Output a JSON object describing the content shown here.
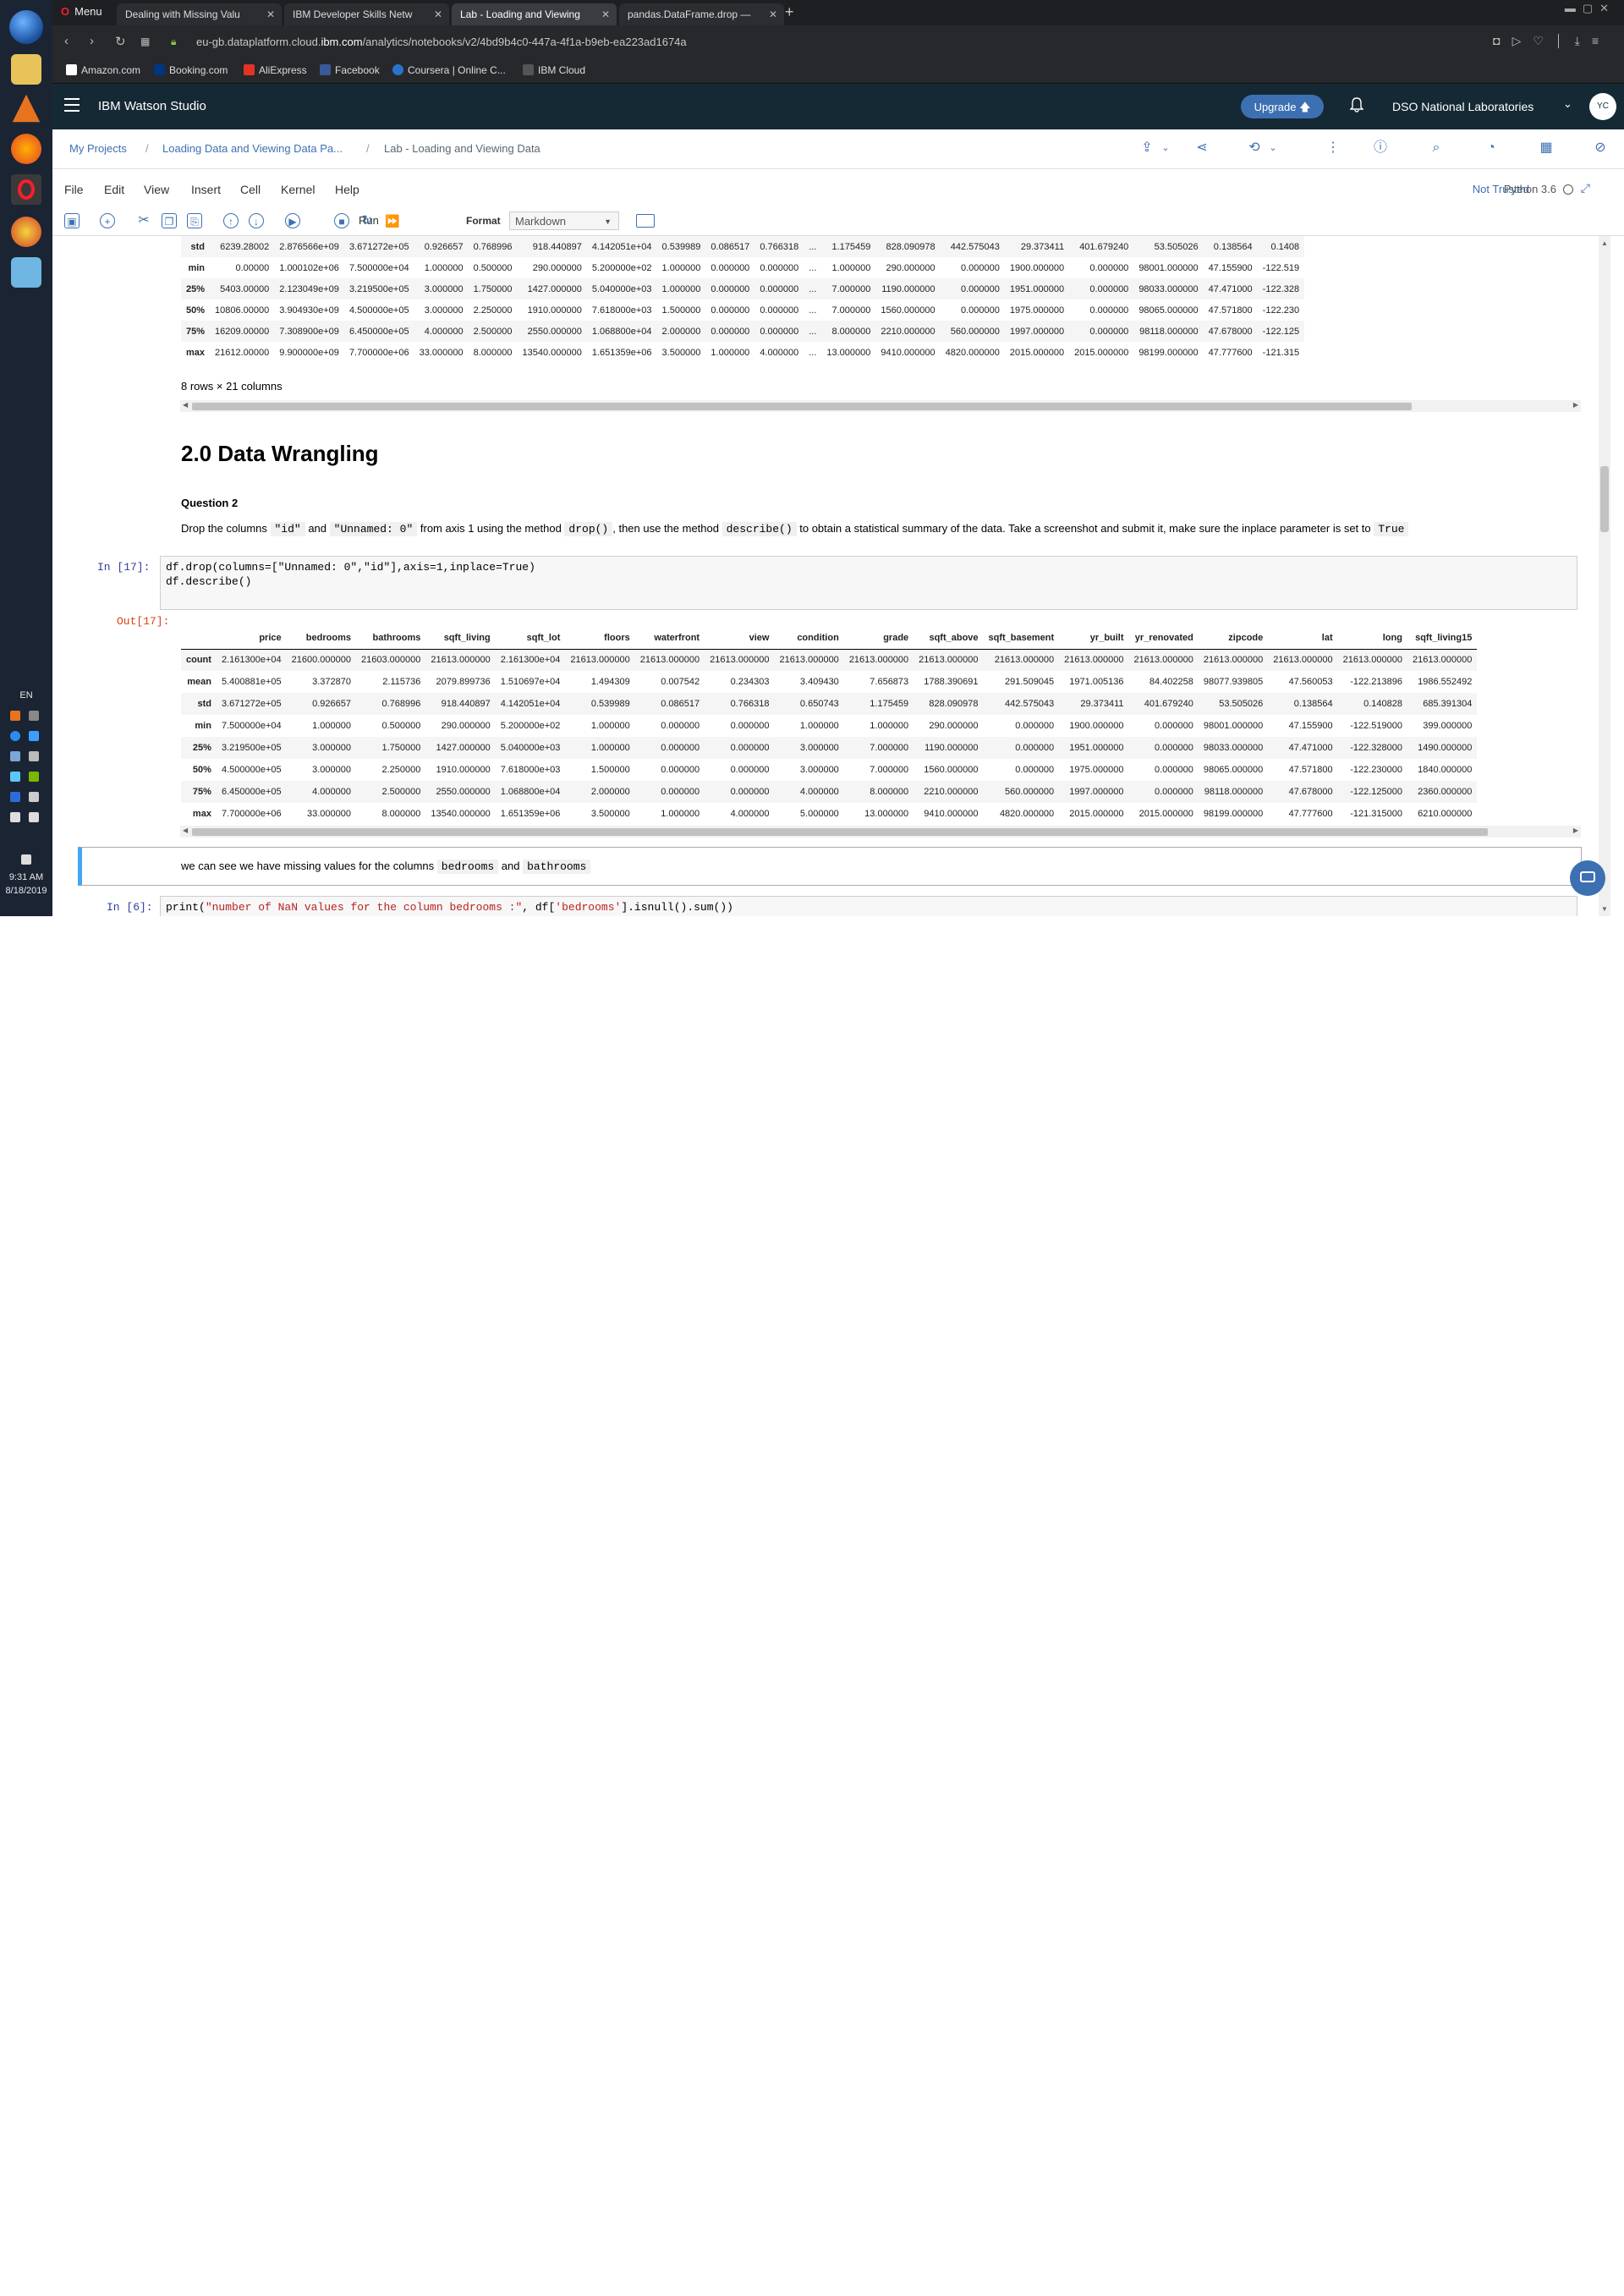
{
  "taskbar": {
    "tray_lang": "EN",
    "clock_time": "9:31 AM",
    "clock_date": "8/18/2019"
  },
  "browser": {
    "menu_label": "Menu",
    "tabs": [
      {
        "label": "Dealing with Missing Valu"
      },
      {
        "label": "IBM Developer Skills Netw"
      },
      {
        "label": "Lab - Loading and Viewing"
      },
      {
        "label": "pandas.DataFrame.drop —"
      }
    ],
    "url_pre": "eu-gb.dataplatform.cloud.",
    "url_domain": "ibm.com",
    "url_post": "/analytics/notebooks/v2/4bd9b4c0-447a-4f1a-b9eb-ea223ad1674a",
    "bookmarks": [
      "Amazon.com",
      "Booking.com",
      "AliExpress",
      "Facebook",
      "Coursera | Online C...",
      "IBM Cloud"
    ]
  },
  "watson": {
    "brand": "IBM Watson Studio",
    "upgrade": "Upgrade",
    "org": "DSO National Laboratories",
    "avatar": "YC"
  },
  "breadcrumb": {
    "items": [
      "My Projects",
      "Loading Data and Viewing Data Pa...",
      "Lab - Loading and Viewing Data"
    ],
    "separator": "/"
  },
  "jupyter": {
    "menu": [
      "File",
      "Edit",
      "View",
      "Insert",
      "Cell",
      "Kernel",
      "Help"
    ],
    "trust": "Not Trusted",
    "kernel": "Python 3.6",
    "run_label": "Run",
    "format_label": "Format",
    "format_value": "Markdown"
  },
  "out_prev": {
    "rows": [
      {
        "stat": "std",
        "cells": [
          "6239.28002",
          "2.876566e+09",
          "3.671272e+05",
          "0.926657",
          "0.768996",
          "918.440897",
          "4.142051e+04",
          "0.539989",
          "0.086517",
          "0.766318",
          "...",
          "1.175459",
          "828.090978",
          "442.575043",
          "29.373411",
          "401.679240",
          "53.505026",
          "0.138564",
          "0.1408"
        ]
      },
      {
        "stat": "min",
        "cells": [
          "0.00000",
          "1.000102e+06",
          "7.500000e+04",
          "1.000000",
          "0.500000",
          "290.000000",
          "5.200000e+02",
          "1.000000",
          "0.000000",
          "0.000000",
          "...",
          "1.000000",
          "290.000000",
          "0.000000",
          "1900.000000",
          "0.000000",
          "98001.000000",
          "47.155900",
          "-122.519"
        ]
      },
      {
        "stat": "25%",
        "cells": [
          "5403.00000",
          "2.123049e+09",
          "3.219500e+05",
          "3.000000",
          "1.750000",
          "1427.000000",
          "5.040000e+03",
          "1.000000",
          "0.000000",
          "0.000000",
          "...",
          "7.000000",
          "1190.000000",
          "0.000000",
          "1951.000000",
          "0.000000",
          "98033.000000",
          "47.471000",
          "-122.328"
        ]
      },
      {
        "stat": "50%",
        "cells": [
          "10806.00000",
          "3.904930e+09",
          "4.500000e+05",
          "3.000000",
          "2.250000",
          "1910.000000",
          "7.618000e+03",
          "1.500000",
          "0.000000",
          "0.000000",
          "...",
          "7.000000",
          "1560.000000",
          "0.000000",
          "1975.000000",
          "0.000000",
          "98065.000000",
          "47.571800",
          "-122.230"
        ]
      },
      {
        "stat": "75%",
        "cells": [
          "16209.00000",
          "7.308900e+09",
          "6.450000e+05",
          "4.000000",
          "2.500000",
          "2550.000000",
          "1.068800e+04",
          "2.000000",
          "0.000000",
          "0.000000",
          "...",
          "8.000000",
          "2210.000000",
          "560.000000",
          "1997.000000",
          "0.000000",
          "98118.000000",
          "47.678000",
          "-122.125"
        ]
      },
      {
        "stat": "max",
        "cells": [
          "21612.00000",
          "9.900000e+09",
          "7.700000e+06",
          "33.000000",
          "8.000000",
          "13540.000000",
          "1.651359e+06",
          "3.500000",
          "1.000000",
          "4.000000",
          "...",
          "13.000000",
          "9410.000000",
          "4820.000000",
          "2015.000000",
          "2015.000000",
          "98199.000000",
          "47.777600",
          "-121.315"
        ]
      }
    ],
    "shape": "8 rows × 21 columns"
  },
  "section": {
    "heading": "2.0 Data Wrangling",
    "question": "Question 2",
    "q_t1": "Drop the columns ",
    "q_c1": "\"id\"",
    "q_t2": " and ",
    "q_c2": "\"Unnamed: 0\"",
    "q_t3": " from axis 1 using the method ",
    "q_c3": "drop()",
    "q_t4": ", then use the method ",
    "q_c4": "describe()",
    "q_t5": " to obtain a statistical summary of the data. Take a screenshot and submit it, make sure the inplace parameter is set to ",
    "q_c5": "True"
  },
  "cell17": {
    "in_prompt": "In [17]:",
    "out_prompt": "Out[17]:",
    "code_line1": "df.drop(columns=[\"Unnamed: 0\",\"id\"],axis=1,inplace=True)",
    "code_line2": "df.describe()"
  },
  "out17": {
    "columns": [
      "price",
      "bedrooms",
      "bathrooms",
      "sqft_living",
      "sqft_lot",
      "floors",
      "waterfront",
      "view",
      "condition",
      "grade",
      "sqft_above",
      "sqft_basement",
      "yr_built",
      "yr_renovated",
      "zipcode",
      "lat",
      "long",
      "sqft_living15"
    ],
    "rows": [
      {
        "stat": "count",
        "cells": [
          "2.161300e+04",
          "21600.000000",
          "21603.000000",
          "21613.000000",
          "2.161300e+04",
          "21613.000000",
          "21613.000000",
          "21613.000000",
          "21613.000000",
          "21613.000000",
          "21613.000000",
          "21613.000000",
          "21613.000000",
          "21613.000000",
          "21613.000000",
          "21613.000000",
          "21613.000000",
          "21613.000000"
        ]
      },
      {
        "stat": "mean",
        "cells": [
          "5.400881e+05",
          "3.372870",
          "2.115736",
          "2079.899736",
          "1.510697e+04",
          "1.494309",
          "0.007542",
          "0.234303",
          "3.409430",
          "7.656873",
          "1788.390691",
          "291.509045",
          "1971.005136",
          "84.402258",
          "98077.939805",
          "47.560053",
          "-122.213896",
          "1986.552492"
        ]
      },
      {
        "stat": "std",
        "cells": [
          "3.671272e+05",
          "0.926657",
          "0.768996",
          "918.440897",
          "4.142051e+04",
          "0.539989",
          "0.086517",
          "0.766318",
          "0.650743",
          "1.175459",
          "828.090978",
          "442.575043",
          "29.373411",
          "401.679240",
          "53.505026",
          "0.138564",
          "0.140828",
          "685.391304"
        ]
      },
      {
        "stat": "min",
        "cells": [
          "7.500000e+04",
          "1.000000",
          "0.500000",
          "290.000000",
          "5.200000e+02",
          "1.000000",
          "0.000000",
          "0.000000",
          "1.000000",
          "1.000000",
          "290.000000",
          "0.000000",
          "1900.000000",
          "0.000000",
          "98001.000000",
          "47.155900",
          "-122.519000",
          "399.000000"
        ]
      },
      {
        "stat": "25%",
        "cells": [
          "3.219500e+05",
          "3.000000",
          "1.750000",
          "1427.000000",
          "5.040000e+03",
          "1.000000",
          "0.000000",
          "0.000000",
          "3.000000",
          "7.000000",
          "1190.000000",
          "0.000000",
          "1951.000000",
          "0.000000",
          "98033.000000",
          "47.471000",
          "-122.328000",
          "1490.000000"
        ]
      },
      {
        "stat": "50%",
        "cells": [
          "4.500000e+05",
          "3.000000",
          "2.250000",
          "1910.000000",
          "7.618000e+03",
          "1.500000",
          "0.000000",
          "0.000000",
          "3.000000",
          "7.000000",
          "1560.000000",
          "0.000000",
          "1975.000000",
          "0.000000",
          "98065.000000",
          "47.571800",
          "-122.230000",
          "1840.000000"
        ]
      },
      {
        "stat": "75%",
        "cells": [
          "6.450000e+05",
          "4.000000",
          "2.500000",
          "2550.000000",
          "1.068800e+04",
          "2.000000",
          "0.000000",
          "0.000000",
          "4.000000",
          "8.000000",
          "2210.000000",
          "560.000000",
          "1997.000000",
          "0.000000",
          "98118.000000",
          "47.678000",
          "-122.125000",
          "2360.000000"
        ]
      },
      {
        "stat": "max",
        "cells": [
          "7.700000e+06",
          "33.000000",
          "8.000000",
          "13540.000000",
          "1.651359e+06",
          "3.500000",
          "1.000000",
          "4.000000",
          "5.000000",
          "13.000000",
          "9410.000000",
          "4820.000000",
          "2015.000000",
          "2015.000000",
          "98199.000000",
          "47.777600",
          "-121.315000",
          "6210.000000"
        ]
      }
    ]
  },
  "note": {
    "t1": "we can see we have missing values for the columns ",
    "c1": "bedrooms",
    "t2": " and ",
    "c2": "bathrooms"
  },
  "cell6": {
    "in_prompt": "In [6]:",
    "code_pre": "print(",
    "code_str": "\"number of NaN values for the column bedrooms :\"",
    "code_mid": ", df[",
    "code_str2": "'bedrooms'",
    "code_post": "].isnull().sum())"
  }
}
